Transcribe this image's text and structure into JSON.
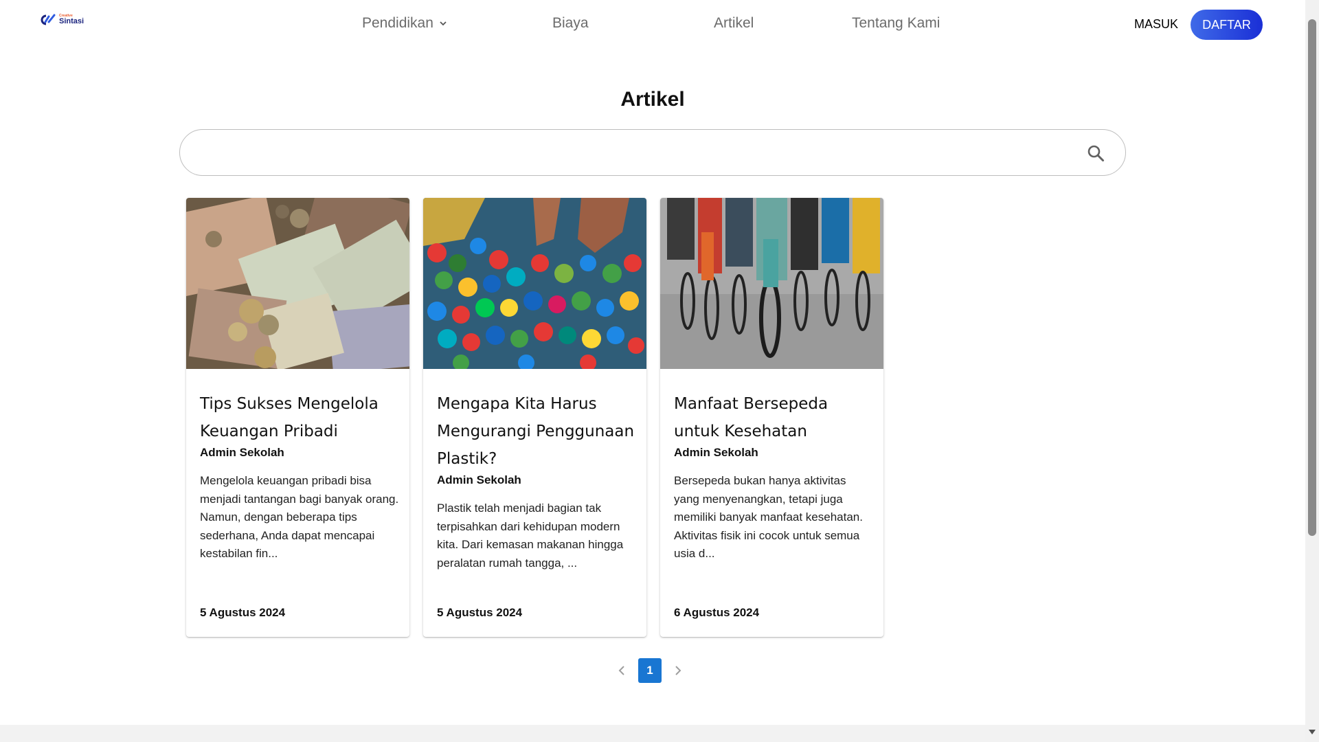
{
  "header": {
    "logo": {
      "small": "Creative",
      "big": "Sintasi"
    },
    "nav": [
      {
        "label": "Pendidikan",
        "has_dropdown": true
      },
      {
        "label": "Biaya"
      },
      {
        "label": "Artikel"
      },
      {
        "label": "Tentang Kami"
      }
    ],
    "login_label": "MASUK",
    "register_label": "DAFTAR"
  },
  "main": {
    "title": "Artikel",
    "search": {
      "value": "",
      "placeholder": ""
    },
    "articles": [
      {
        "title": "Tips Sukses Mengelola Keuangan Pribadi",
        "author": "Admin Sekolah",
        "excerpt": "Mengelola keuangan pribadi bisa menjadi tantangan bagi banyak orang. Namun, dengan beberapa tips sederhana, Anda dapat mencapai kestabilan fin...",
        "date": "5 Agustus 2024",
        "image": "money-photo"
      },
      {
        "title": "Mengapa Kita Harus Mengurangi Penggunaan Plastik?",
        "author": "Admin Sekolah",
        "excerpt": "Plastik telah menjadi bagian tak terpisahkan dari kehidupan modern kita. Dari kemasan makanan hingga peralatan rumah tangga, ...",
        "date": "5 Agustus 2024",
        "image": "plastic-caps-photo"
      },
      {
        "title": "Manfaat Bersepeda untuk Kesehatan",
        "author": "Admin Sekolah",
        "excerpt": "Bersepeda bukan hanya aktivitas yang menyenangkan, tetapi juga memiliki banyak manfaat kesehatan. Aktivitas fisik ini cocok untuk semua usia d...",
        "date": "6 Agustus 2024",
        "image": "cyclists-photo"
      }
    ],
    "pagination": {
      "current": "1",
      "prev_icon": "chevron-left-icon",
      "next_icon": "chevron-right-icon"
    }
  },
  "colors": {
    "accent": "#1976d2",
    "register_gradient": [
      "#3f6ae8",
      "#1a2fd6"
    ],
    "nav_text": "#6b6b6b"
  }
}
